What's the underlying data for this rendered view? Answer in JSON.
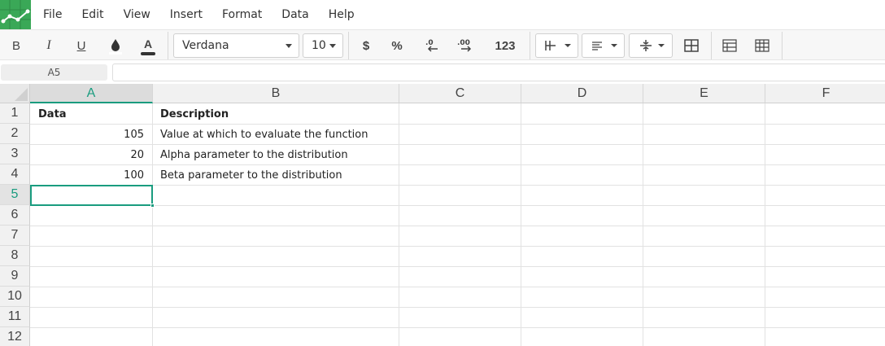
{
  "menu": [
    "File",
    "Edit",
    "View",
    "Insert",
    "Format",
    "Data",
    "Help"
  ],
  "toolbar": {
    "bold": "B",
    "italic": "I",
    "underline": "U",
    "text_color_glyph": "A",
    "font_name": "Verdana",
    "font_size": "10",
    "currency": "$",
    "percent": "%",
    "dec_decrease": ".0",
    "dec_increase": ".00",
    "number_format": "123"
  },
  "formula_bar": {
    "cell_ref": "A5",
    "value": ""
  },
  "columns": [
    "A",
    "B",
    "C",
    "D",
    "E",
    "F"
  ],
  "rows": [
    "1",
    "2",
    "3",
    "4",
    "5",
    "6",
    "7",
    "8",
    "9",
    "10",
    "11",
    "12"
  ],
  "selected": {
    "column": "A",
    "row": "5"
  },
  "cells": {
    "A1": "Data",
    "B1": "Description",
    "A2": "105",
    "B2": "Value at which to evaluate the function",
    "A3": "20",
    "B3": "Alpha parameter to the distribution",
    "A4": "100",
    "B4": "Beta parameter to the distribution"
  },
  "colors": {
    "accent": "#1a9c7f",
    "logo": "#3aa857"
  }
}
